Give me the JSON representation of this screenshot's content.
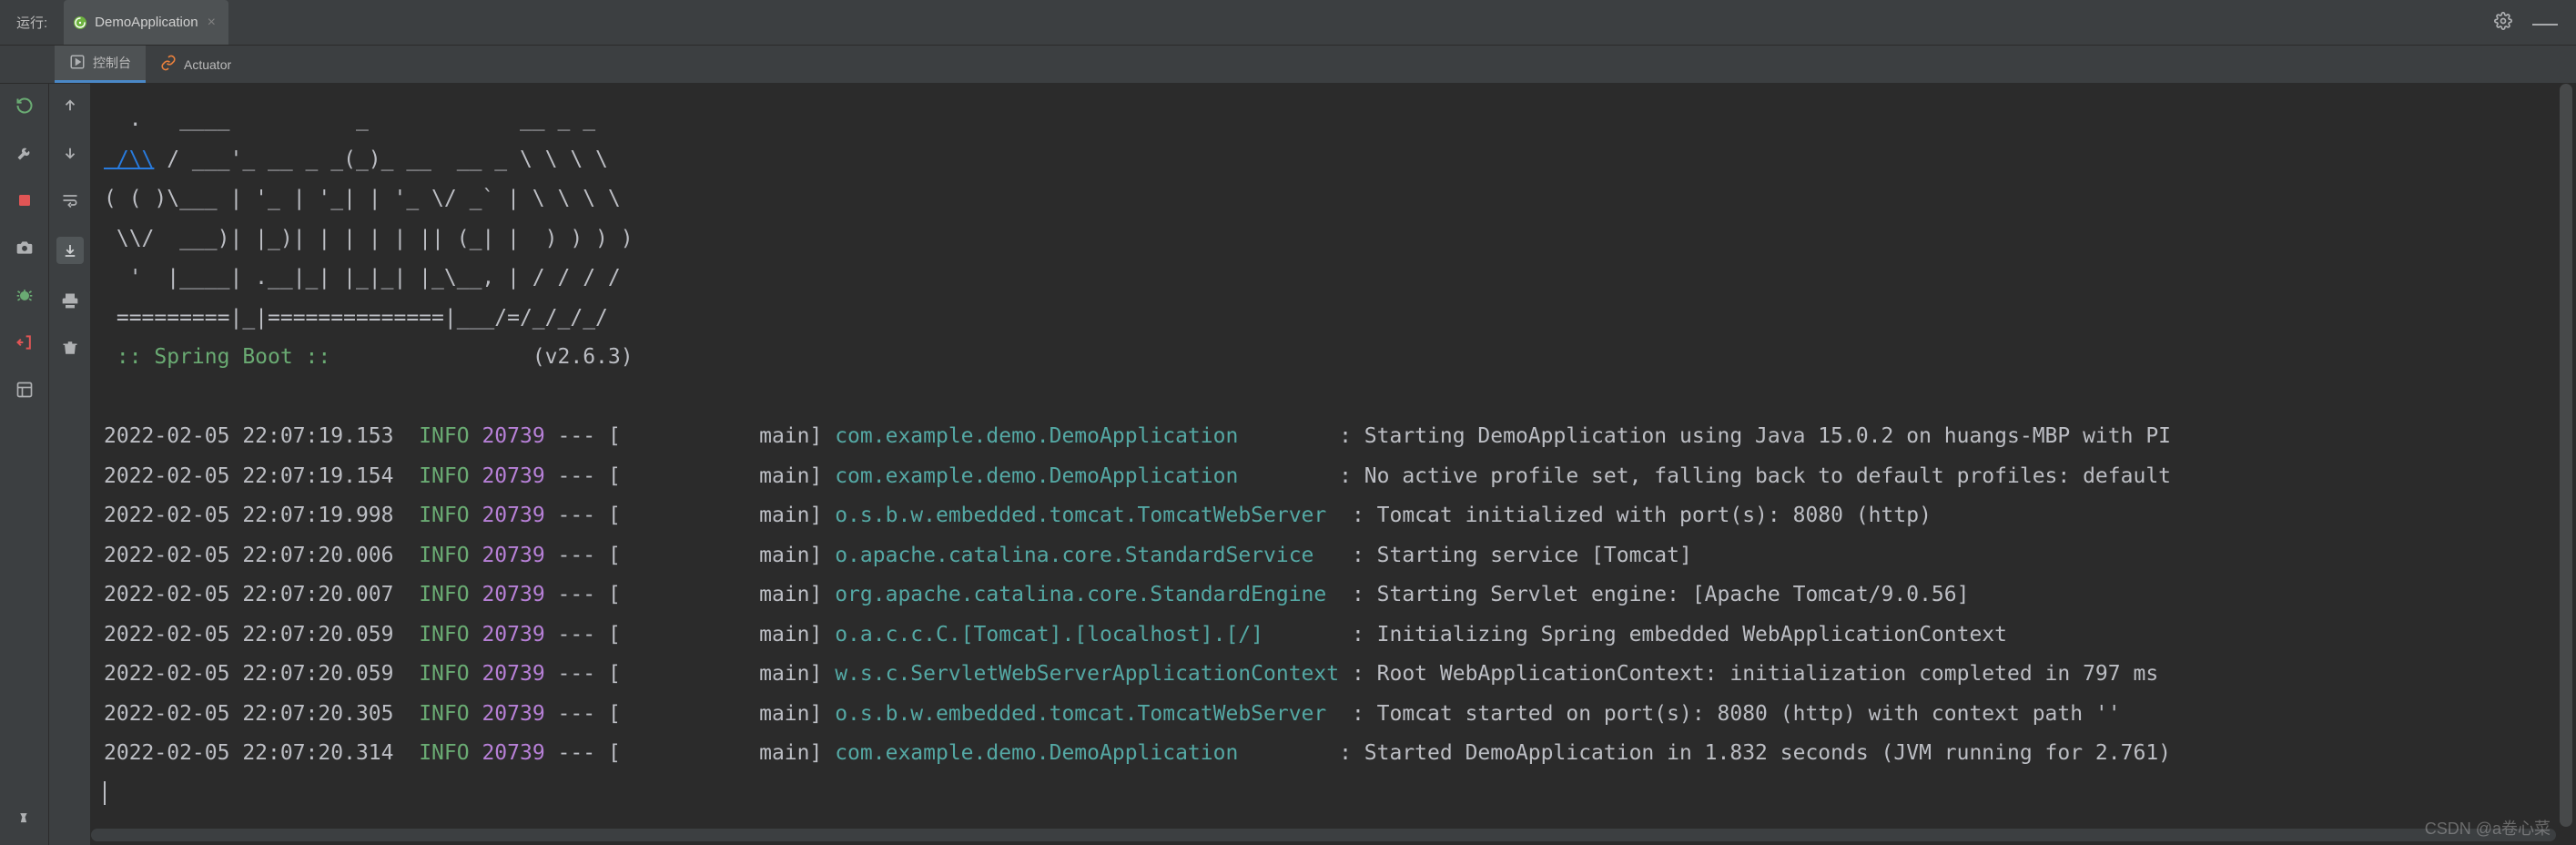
{
  "header": {
    "run_label": "运行:",
    "config_name": "DemoApplication",
    "close_glyph": "×"
  },
  "tabs": {
    "console": {
      "label": "控制台",
      "icon": "play-square"
    },
    "actuator": {
      "label": "Actuator",
      "icon": "link"
    }
  },
  "banner": {
    "lines": [
      "  .   ____          _            __ _ _",
      " /\\\\ / ___'_ __ _ _(_)_ __  __ _ \\ \\ \\ \\",
      "( ( )\\___ | '_ | '_| | '_ \\/ _` | \\ \\ \\ \\",
      " \\\\/  ___)| |_)| | | | | || (_| |  ) ) ) )",
      "  '  |____| .__|_| |_|_| |_\\__, | / / / /",
      " =========|_|==============|___/=/_/_/_/"
    ],
    "spring_boot_label": " :: Spring Boot :: ",
    "spring_boot_version": "(v2.6.3)"
  },
  "log": {
    "pid": "20739",
    "level": "INFO",
    "thread": "main",
    "rows": [
      {
        "ts": "2022-02-05 22:07:19.153",
        "logger": "com.example.demo.DemoApplication       ",
        "msg": "Starting DemoApplication using Java 15.0.2 on huangs-MBP with PI"
      },
      {
        "ts": "2022-02-05 22:07:19.154",
        "logger": "com.example.demo.DemoApplication       ",
        "msg": "No active profile set, falling back to default profiles: default"
      },
      {
        "ts": "2022-02-05 22:07:19.998",
        "logger": "o.s.b.w.embedded.tomcat.TomcatWebServer ",
        "msg": "Tomcat initialized with port(s): 8080 (http)"
      },
      {
        "ts": "2022-02-05 22:07:20.006",
        "logger": "o.apache.catalina.core.StandardService  ",
        "msg": "Starting service [Tomcat]"
      },
      {
        "ts": "2022-02-05 22:07:20.007",
        "logger": "org.apache.catalina.core.StandardEngine ",
        "msg": "Starting Servlet engine: [Apache Tomcat/9.0.56]"
      },
      {
        "ts": "2022-02-05 22:07:20.059",
        "logger": "o.a.c.c.C.[Tomcat].[localhost].[/]      ",
        "msg": "Initializing Spring embedded WebApplicationContext"
      },
      {
        "ts": "2022-02-05 22:07:20.059",
        "logger": "w.s.c.ServletWebServerApplicationContext",
        "msg": "Root WebApplicationContext: initialization completed in 797 ms"
      },
      {
        "ts": "2022-02-05 22:07:20.305",
        "logger": "o.s.b.w.embedded.tomcat.TomcatWebServer ",
        "msg": "Tomcat started on port(s): 8080 (http) with context path ''"
      },
      {
        "ts": "2022-02-05 22:07:20.314",
        "logger": "com.example.demo.DemoApplication       ",
        "msg": "Started DemoApplication in 1.832 seconds (JVM running for 2.761)"
      }
    ]
  },
  "watermark": "CSDN @a卷心菜"
}
